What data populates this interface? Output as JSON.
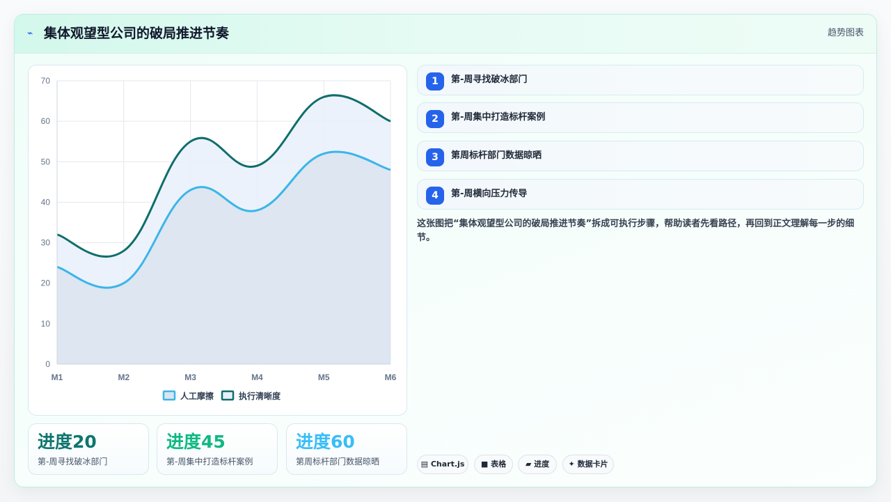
{
  "header": {
    "icon": "trend-icon",
    "icon_glyph": "⌁",
    "title": "集体观望型公司的破局推进节奏",
    "right_label": "趋势图表"
  },
  "chart_data": {
    "type": "area",
    "categories": [
      "M1",
      "M2",
      "M3",
      "M4",
      "M5",
      "M6"
    ],
    "ylim": [
      0,
      70
    ],
    "yticks": [
      0,
      10,
      20,
      30,
      40,
      50,
      60,
      70
    ],
    "grid": true,
    "legend_position": "bottom",
    "series": [
      {
        "name": "人工摩擦",
        "values": [
          24,
          20,
          43,
          38,
          52,
          48
        ],
        "color": "#3bb5e8",
        "fill": "#dbe4ef"
      },
      {
        "name": "执行清晰度",
        "values": [
          32,
          28,
          55,
          49,
          66,
          60
        ],
        "color": "#0f6e6a",
        "fill": "#e8f0fc"
      }
    ]
  },
  "stats": [
    {
      "value": "进度20",
      "label": "第-周寻找破冰部门",
      "color": "#0f766e"
    },
    {
      "value": "进度45",
      "label": "第-周集中打造标杆案例",
      "color": "#10b981"
    },
    {
      "value": "进度60",
      "label": "第周标杆部门数据晾晒",
      "color": "#38bdf8"
    }
  ],
  "steps": [
    {
      "num": "1",
      "label": "第-周寻找破冰部门"
    },
    {
      "num": "2",
      "label": "第-周集中打造标杆案例"
    },
    {
      "num": "3",
      "label": "第周标杆部门数据晾晒"
    },
    {
      "num": "4",
      "label": "第-周横向压力传导"
    }
  ],
  "description": "这张图把“集体观望型公司的破局推进节奏”拆成可执行步骤，帮助读者先看路径，再回到正文理解每一步的细节。",
  "tags": [
    {
      "icon": "chart-icon",
      "glyph": "▤",
      "label": "Chart.js"
    },
    {
      "icon": "table-icon",
      "glyph": "■",
      "label": "表格"
    },
    {
      "icon": "progress-icon",
      "glyph": "▰",
      "label": "进度"
    },
    {
      "icon": "card-icon",
      "glyph": "✦",
      "label": "数据卡片"
    }
  ]
}
